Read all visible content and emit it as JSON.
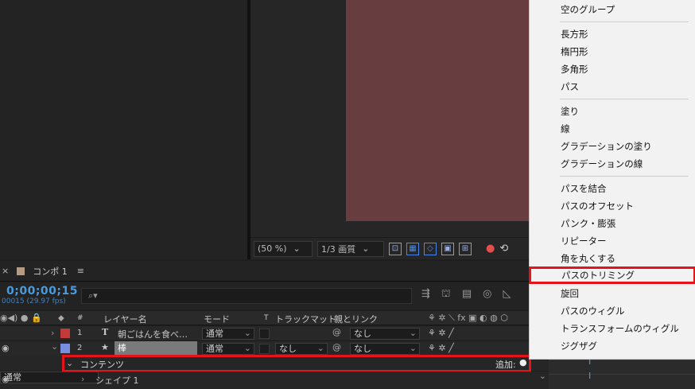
{
  "comp_tab": {
    "close": "×",
    "title": "コンポ 1",
    "menu": "≡"
  },
  "viewer_toolbar": {
    "zoom": "(50 %)",
    "resolution": "1/3 画質"
  },
  "timeline": {
    "timecode": "0;00;00;15",
    "fps": "00015 (29.97 fps)",
    "search_placeholder": "",
    "search_icon": "search-icon",
    "columns": {
      "hash": "#",
      "layer_name": "レイヤー名",
      "mode": "モード",
      "t": "T",
      "track_matte": "トラックマット",
      "parent_link": "親とリンク",
      "switches": "fx"
    },
    "layers": [
      {
        "index": "1",
        "type_glyph": "T",
        "name": "朝ごはんを食べ…",
        "mode": "通常",
        "track_matte": "",
        "parent": "なし",
        "label_color": "#c23a3a"
      },
      {
        "index": "2",
        "type_glyph": "★",
        "name": "棒",
        "mode": "通常",
        "track_matte": "なし",
        "parent": "なし",
        "label_color": "#7a8ee0"
      }
    ],
    "contents": {
      "label": "コンテンツ",
      "add_label": "追加:"
    },
    "shape": {
      "label": "シェイプ 1",
      "mode": "通常"
    }
  },
  "add_menu": {
    "items": [
      {
        "label": "空のグループ"
      },
      {
        "label": "長方形"
      },
      {
        "label": "楕円形"
      },
      {
        "label": "多角形"
      },
      {
        "label": "パス"
      },
      {
        "label": "塗り"
      },
      {
        "label": "線"
      },
      {
        "label": "グラデーションの塗り"
      },
      {
        "label": "グラデーションの線"
      },
      {
        "label": "パスを結合"
      },
      {
        "label": "パスのオフセット"
      },
      {
        "label": "パンク・膨張"
      },
      {
        "label": "リピーター"
      },
      {
        "label": "角を丸くする"
      },
      {
        "label": "パスのトリミング"
      },
      {
        "label": "旋回"
      },
      {
        "label": "パスのウィグル"
      },
      {
        "label": "トランスフォームのウィグル"
      },
      {
        "label": "ジグザグ"
      }
    ],
    "highlighted": "パスのトリミング"
  },
  "colors": {
    "accent_blue": "#4a9ae0",
    "highlight_red": "#e5141a",
    "comp_bg": "#673d3f"
  }
}
